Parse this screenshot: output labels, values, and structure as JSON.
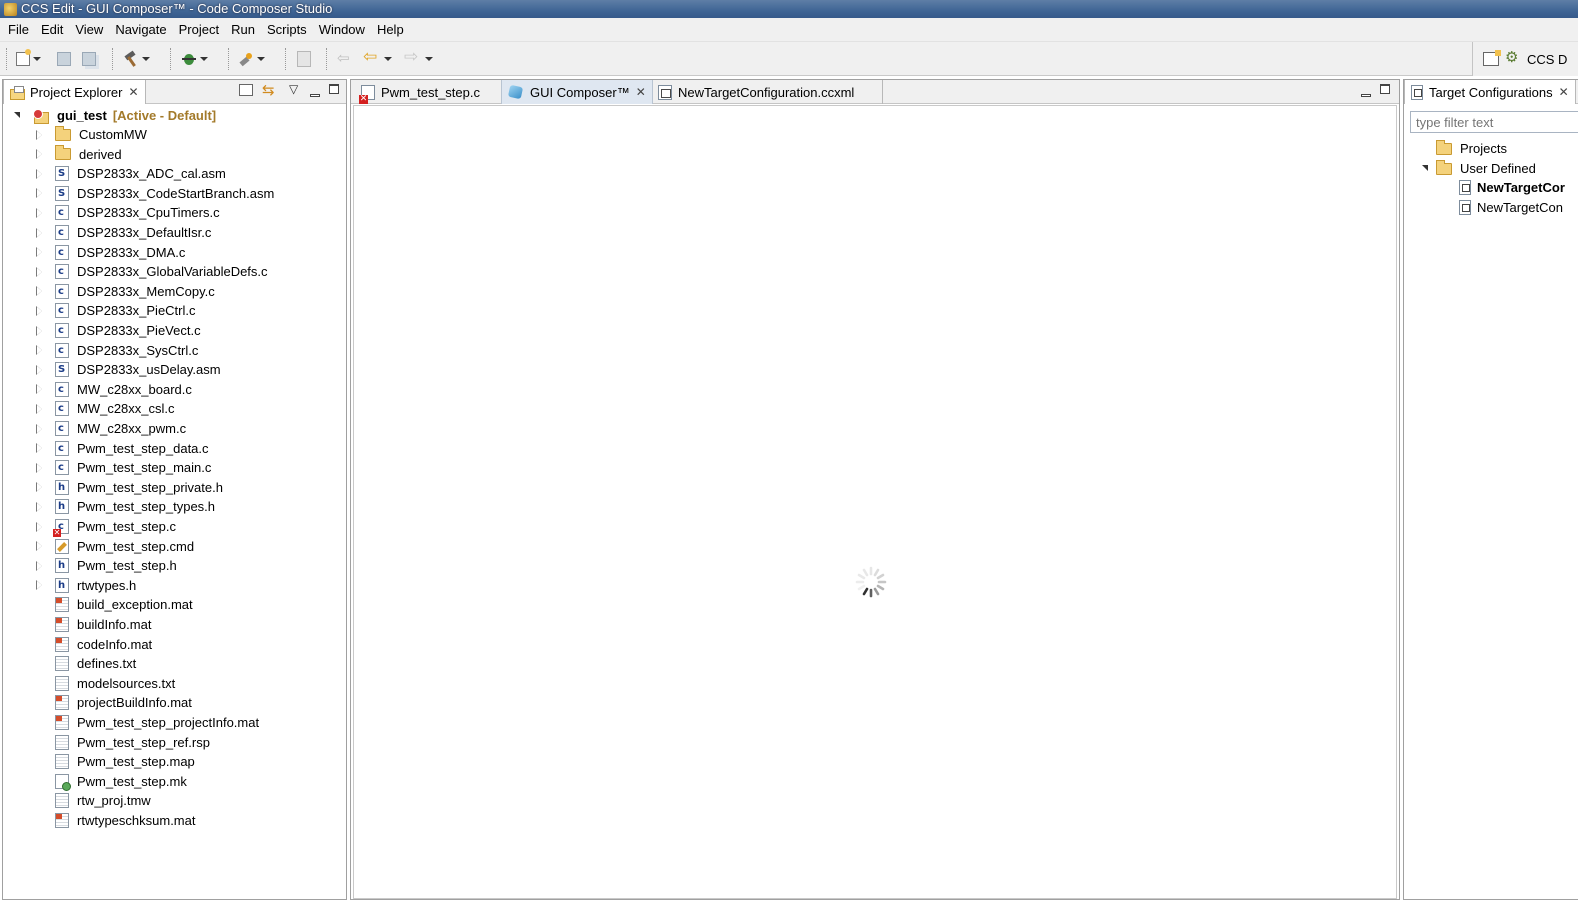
{
  "window": {
    "title": "CCS Edit - GUI Composer™ - Code Composer Studio"
  },
  "menu": [
    "File",
    "Edit",
    "View",
    "Navigate",
    "Project",
    "Run",
    "Scripts",
    "Window",
    "Help"
  ],
  "toolbar": {
    "icons": [
      "new-icon",
      "save-icon",
      "save-all-icon",
      "build-hammer-icon",
      "debug-icon",
      "external-tools-icon",
      "terminate-icon",
      "last-edit-icon",
      "back-icon",
      "forward-icon"
    ]
  },
  "perspective": {
    "label": "CCS D"
  },
  "project_explorer": {
    "tab_label": "Project Explorer",
    "project": {
      "name": "gui_test",
      "state": "[Active - Default]"
    },
    "items": [
      {
        "label": "CustomMW",
        "icon": "folder",
        "expandable": true
      },
      {
        "label": "derived",
        "icon": "folder",
        "expandable": true
      },
      {
        "label": "DSP2833x_ADC_cal.asm",
        "icon": "S",
        "expandable": true
      },
      {
        "label": "DSP2833x_CodeStartBranch.asm",
        "icon": "S",
        "expandable": true
      },
      {
        "label": "DSP2833x_CpuTimers.c",
        "icon": "c",
        "expandable": true
      },
      {
        "label": "DSP2833x_DefaultIsr.c",
        "icon": "c",
        "expandable": true
      },
      {
        "label": "DSP2833x_DMA.c",
        "icon": "c",
        "expandable": true
      },
      {
        "label": "DSP2833x_GlobalVariableDefs.c",
        "icon": "c",
        "expandable": true
      },
      {
        "label": "DSP2833x_MemCopy.c",
        "icon": "c",
        "expandable": true
      },
      {
        "label": "DSP2833x_PieCtrl.c",
        "icon": "c",
        "expandable": true
      },
      {
        "label": "DSP2833x_PieVect.c",
        "icon": "c",
        "expandable": true
      },
      {
        "label": "DSP2833x_SysCtrl.c",
        "icon": "c",
        "expandable": true
      },
      {
        "label": "DSP2833x_usDelay.asm",
        "icon": "S",
        "expandable": true
      },
      {
        "label": "MW_c28xx_board.c",
        "icon": "c",
        "expandable": true
      },
      {
        "label": "MW_c28xx_csl.c",
        "icon": "c",
        "expandable": true
      },
      {
        "label": "MW_c28xx_pwm.c",
        "icon": "c",
        "expandable": true
      },
      {
        "label": "Pwm_test_step_data.c",
        "icon": "c",
        "expandable": true
      },
      {
        "label": "Pwm_test_step_main.c",
        "icon": "c",
        "expandable": true
      },
      {
        "label": "Pwm_test_step_private.h",
        "icon": "h",
        "expandable": true
      },
      {
        "label": "Pwm_test_step_types.h",
        "icon": "h",
        "expandable": true
      },
      {
        "label": "Pwm_test_step.c",
        "icon": "c-error",
        "expandable": true
      },
      {
        "label": "Pwm_test_step.cmd",
        "icon": "cmd",
        "expandable": true
      },
      {
        "label": "Pwm_test_step.h",
        "icon": "h",
        "expandable": true
      },
      {
        "label": "rtwtypes.h",
        "icon": "h",
        "expandable": true
      },
      {
        "label": "build_exception.mat",
        "icon": "mat",
        "expandable": false
      },
      {
        "label": "buildInfo.mat",
        "icon": "mat",
        "expandable": false
      },
      {
        "label": "codeInfo.mat",
        "icon": "mat",
        "expandable": false
      },
      {
        "label": "defines.txt",
        "icon": "txt",
        "expandable": false
      },
      {
        "label": "modelsources.txt",
        "icon": "txt",
        "expandable": false
      },
      {
        "label": "projectBuildInfo.mat",
        "icon": "mat",
        "expandable": false
      },
      {
        "label": "Pwm_test_step_projectInfo.mat",
        "icon": "mat",
        "expandable": false
      },
      {
        "label": "Pwm_test_step_ref.rsp",
        "icon": "txt",
        "expandable": false
      },
      {
        "label": "Pwm_test_step.map",
        "icon": "txt",
        "expandable": false
      },
      {
        "label": "Pwm_test_step.mk",
        "icon": "mk",
        "expandable": false
      },
      {
        "label": "rtw_proj.tmw",
        "icon": "txt",
        "expandable": false
      },
      {
        "label": "rtwtypeschksum.mat",
        "icon": "mat",
        "expandable": false
      }
    ]
  },
  "editor": {
    "tabs": [
      {
        "label": "Pwm_test_step.c",
        "active": false
      },
      {
        "label": "GUI Composer™",
        "active": true
      },
      {
        "label": "NewTargetConfiguration.ccxml",
        "active": false
      }
    ],
    "status": "loading"
  },
  "target_configurations": {
    "tab_label": "Target Configurations",
    "filter_placeholder": "type filter text",
    "tree": [
      {
        "label": "Projects",
        "level": 0,
        "expanded": false
      },
      {
        "label": "User Defined",
        "level": 0,
        "expanded": true
      },
      {
        "label": "NewTargetCor",
        "level": 1,
        "bold": true
      },
      {
        "label": "NewTargetCon",
        "level": 1,
        "bold": false
      }
    ]
  }
}
